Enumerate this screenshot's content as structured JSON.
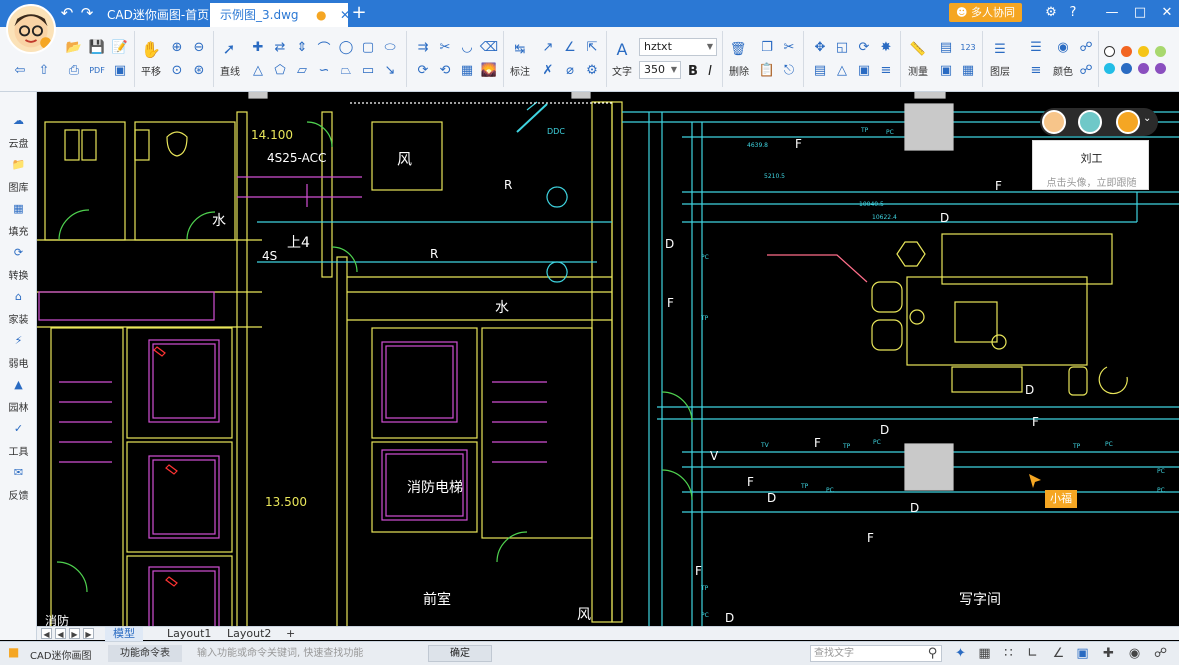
{
  "titlebar": {
    "tabs": [
      {
        "label": "CAD迷你画图-首页"
      },
      {
        "label": "示例图_3.dwg"
      }
    ],
    "collab_button": "多人协同"
  },
  "ribbon": {
    "labels": {
      "pan": "平移",
      "line": "直线",
      "dimension": "标注",
      "text": "文字",
      "delete": "删除",
      "measure": "测量",
      "layer": "图层",
      "color": "颜色"
    },
    "font_name": "hztxt",
    "font_size": "350",
    "bold": "B",
    "italic": "I",
    "palette": [
      "#ffffff",
      "#f26522",
      "#f5c518",
      "#a8d86e",
      "#22bde6",
      "#2a6bc2",
      "#8a4fbf"
    ]
  },
  "sidebar": {
    "items": [
      {
        "label": "云盘",
        "icon": "cloud-icon"
      },
      {
        "label": "图库",
        "icon": "folder-icon"
      },
      {
        "label": "填充",
        "icon": "fill-icon"
      },
      {
        "label": "转换",
        "icon": "convert-icon"
      },
      {
        "label": "家装",
        "icon": "home-icon"
      },
      {
        "label": "弱电",
        "icon": "electric-icon"
      },
      {
        "label": "园林",
        "icon": "tree-icon"
      },
      {
        "label": "工具",
        "icon": "tool-icon"
      },
      {
        "label": "反馈",
        "icon": "mail-icon"
      }
    ]
  },
  "drawing": {
    "labels": {
      "elev1": "14.100",
      "elev2": "13.500",
      "beam": "4S25-ACC",
      "s4": "4S",
      "up4": "上4",
      "wind": "风",
      "water": "水",
      "r": "R",
      "fire_elevator": "消防电梯",
      "lobby": "前室",
      "office": "写字间",
      "ddc": "DDC",
      "f": "F",
      "d": "D",
      "v": "V",
      "tp": "TP",
      "pc": "PC",
      "tv": "TV",
      "dim1": "4639.8",
      "dim2": "5210.5",
      "dim3": "10040.5",
      "dim4": "10622.4",
      "corner": "消防"
    }
  },
  "collab": {
    "popup_name": "刘工",
    "popup_hint": "点击头像，立即跟随",
    "cursor_name": "小福"
  },
  "layouts": {
    "tabs": [
      "模型",
      "Layout1",
      "Layout2"
    ],
    "add": "+"
  },
  "statusbar": {
    "app_name": "CAD迷你画图",
    "cmd_tab": "功能命令表",
    "cmd_placeholder": "输入功能或命令关键词, 快速查找功能",
    "ok": "确定",
    "search_placeholder": "查找文字"
  }
}
